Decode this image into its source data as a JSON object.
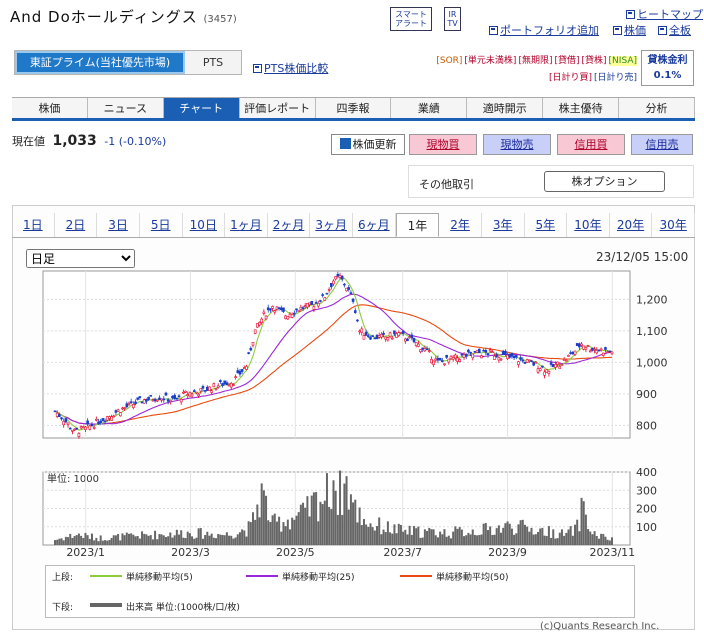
{
  "header": {
    "company": "And Doホールディングス",
    "code": "(3457)",
    "badge_smart_alert": "スマート\nアラート",
    "badge_ir_tv": "IR\nTV",
    "heatmap": "ヒートマップ",
    "add_portfolio": "ポートフォリオ追加",
    "stock": "株価",
    "board": "全板"
  },
  "market": {
    "primary": "東証プライム(当社優先市場)",
    "pts": "PTS",
    "compare": "PTS株価比較"
  },
  "tags": {
    "row1": [
      "[SOR]",
      "[単元未満株]",
      "[無期限]",
      "[貸借]",
      "[貸株]",
      "[NISA]"
    ],
    "row2": [
      "[日計り買]",
      "[日計り売]"
    ]
  },
  "fee": {
    "label": "貸株金利",
    "value": "0.1%"
  },
  "tabs": [
    "株価",
    "ニュース",
    "チャート",
    "評価レポート",
    "四季報",
    "業績",
    "適時開示",
    "株主優待",
    "分析"
  ],
  "selected_tab": 2,
  "price": {
    "label": "現在値",
    "value": "1,033",
    "change": "-1 (-0.10%)"
  },
  "actions": {
    "update": "株価更新",
    "cash_buy": "現物買",
    "cash_sell": "現物売",
    "margin_buy": "信用買",
    "margin_sell": "信用売"
  },
  "other_trade": {
    "label": "その他取引",
    "option_button": "株オプション"
  },
  "periods": [
    "1日",
    "2日",
    "3日",
    "5日",
    "10日",
    "1ヶ月",
    "2ヶ月",
    "3ヶ月",
    "6ヶ月",
    "1年",
    "2年",
    "3年",
    "5年",
    "10年",
    "20年",
    "30年"
  ],
  "selected_period": 9,
  "chart_controls": {
    "interval": "日足",
    "timestamp": "23/12/05 15:00"
  },
  "colors": {
    "accent": "#1a5fb4",
    "up": "#e8002a",
    "down": "#1a3fc8",
    "ma5": "#8ccc3c",
    "ma25": "#9b27d9",
    "ma50": "#e84c10"
  },
  "legend": {
    "upper": "上段:",
    "ma5": "単純移動平均(5)",
    "ma25": "単純移動平均(25)",
    "ma50": "単純移動平均(50)",
    "lower": "下段:",
    "volume": "出来高 単位:(1000株/口/枚)"
  },
  "footer": "(c)Quants Research Inc.",
  "chart_data": {
    "type": "candlestick",
    "price_axis": {
      "ticks": [
        "1,200",
        "1,100",
        "1,000",
        "900",
        "800"
      ],
      "ylim": [
        760,
        1290
      ]
    },
    "volume_axis": {
      "unit": "単位: 1000",
      "ticks": [
        "400",
        "300",
        "200",
        "100"
      ],
      "ylim": [
        0,
        400
      ]
    },
    "x_labels": [
      "2023/1",
      "2023/3",
      "2023/5",
      "2023/7",
      "2023/9",
      "2023/11"
    ],
    "close_keypoints": [
      [
        0,
        845
      ],
      [
        4,
        820
      ],
      [
        9,
        780
      ],
      [
        14,
        790
      ],
      [
        22,
        820
      ],
      [
        30,
        850
      ],
      [
        40,
        880
      ],
      [
        48,
        890
      ],
      [
        55,
        880
      ],
      [
        60,
        900
      ],
      [
        68,
        910
      ],
      [
        76,
        930
      ],
      [
        82,
        940
      ],
      [
        88,
        990
      ],
      [
        92,
        1100
      ],
      [
        96,
        1150
      ],
      [
        100,
        1180
      ],
      [
        106,
        1150
      ],
      [
        112,
        1170
      ],
      [
        118,
        1180
      ],
      [
        124,
        1210
      ],
      [
        128,
        1260
      ],
      [
        131,
        1270
      ],
      [
        134,
        1240
      ],
      [
        137,
        1200
      ],
      [
        140,
        1100
      ],
      [
        146,
        1080
      ],
      [
        152,
        1080
      ],
      [
        158,
        1090
      ],
      [
        164,
        1070
      ],
      [
        170,
        1040
      ],
      [
        176,
        1000
      ],
      [
        182,
        1010
      ],
      [
        188,
        1020
      ],
      [
        194,
        1030
      ],
      [
        200,
        1030
      ],
      [
        206,
        1020
      ],
      [
        212,
        1010
      ],
      [
        218,
        1000
      ],
      [
        222,
        990
      ],
      [
        226,
        975
      ],
      [
        230,
        990
      ],
      [
        234,
        1005
      ],
      [
        238,
        1030
      ],
      [
        242,
        1060
      ],
      [
        246,
        1045
      ],
      [
        250,
        1040
      ],
      [
        254,
        1035
      ],
      [
        256,
        1033
      ]
    ],
    "volume_keypoints": [
      [
        0,
        30
      ],
      [
        10,
        60
      ],
      [
        20,
        40
      ],
      [
        40,
        55
      ],
      [
        60,
        70
      ],
      [
        80,
        60
      ],
      [
        90,
        100
      ],
      [
        95,
        300
      ],
      [
        100,
        120
      ],
      [
        115,
        180
      ],
      [
        120,
        250
      ],
      [
        126,
        300
      ],
      [
        128,
        400
      ],
      [
        130,
        280
      ],
      [
        134,
        350
      ],
      [
        138,
        200
      ],
      [
        145,
        120
      ],
      [
        160,
        80
      ],
      [
        180,
        70
      ],
      [
        200,
        90
      ],
      [
        210,
        110
      ],
      [
        225,
        80
      ],
      [
        235,
        60
      ],
      [
        240,
        100
      ],
      [
        243,
        250
      ],
      [
        246,
        70
      ],
      [
        256,
        30
      ]
    ]
  }
}
